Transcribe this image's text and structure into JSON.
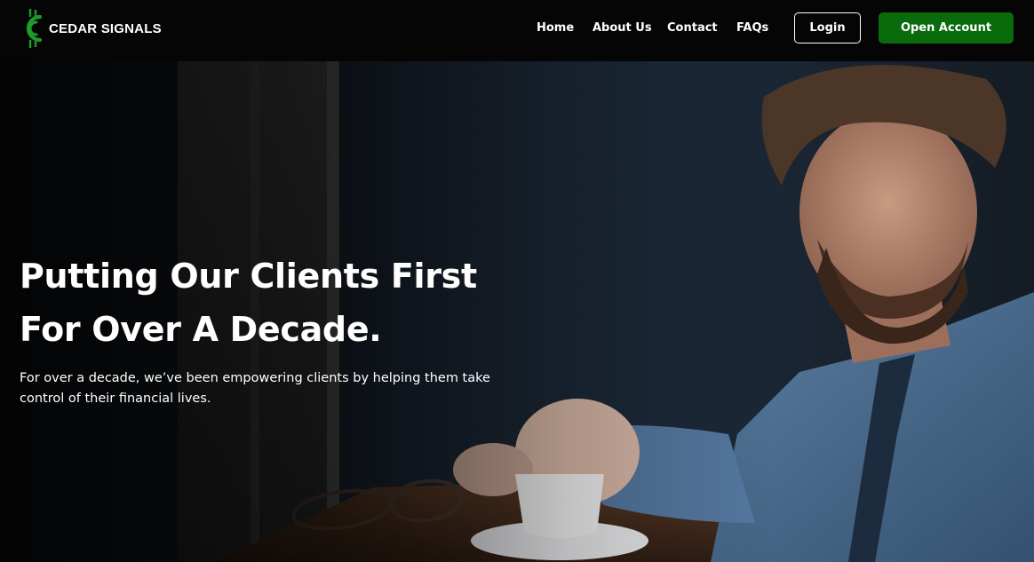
{
  "brand": {
    "name": "CEDAR SIGNALS",
    "icon": "cedar-signals-logo-icon",
    "accent": "#0a6b0d"
  },
  "nav": {
    "links": [
      {
        "label": "Home"
      },
      {
        "label": "About Us"
      },
      {
        "label": "Contact"
      },
      {
        "label": "FAQs"
      }
    ],
    "login_label": "Login",
    "open_account_label": "Open Account"
  },
  "hero": {
    "title_line1": "Putting Our Clients First",
    "title_line2": "For Over A Decade.",
    "subtitle": "For over a decade, we’ve been empowering clients by helping them take control of their financial lives."
  }
}
